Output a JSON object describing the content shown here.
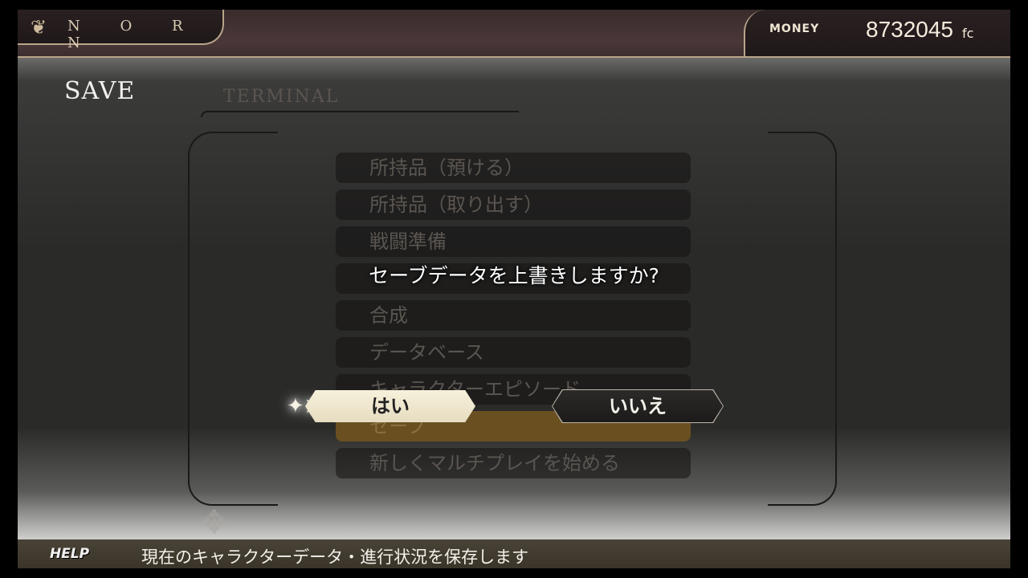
{
  "header": {
    "brand": "N O R N",
    "brand_icon": "fleur-icon",
    "money_label": "MONEY",
    "money_value": "8732045",
    "money_unit": "fc"
  },
  "screen": {
    "title": "SAVE",
    "section_label": "TERMINAL"
  },
  "menu": {
    "items": [
      {
        "label": "所持品（預ける）"
      },
      {
        "label": "所持品（取り出す）"
      },
      {
        "label": "戦闘準備"
      },
      {
        "label": ""
      },
      {
        "label": "合成"
      },
      {
        "label": "データベース"
      },
      {
        "label": "キャラクターエピソード"
      },
      {
        "label": "セーブ",
        "active": true
      },
      {
        "label": "新しくマルチプレイを始める"
      }
    ]
  },
  "dialog": {
    "message": "セーブデータを上書きしますか?",
    "yes_label": "はい",
    "no_label": "いいえ",
    "cursor_icon": "pointer-cursor-icon"
  },
  "help": {
    "label": "HELP",
    "text": "現在のキャラクターデータ・進行状況を保存します"
  },
  "colors": {
    "accent": "#b9a48a",
    "topbar": "#3a2b2c",
    "highlight": "#6a5021"
  }
}
